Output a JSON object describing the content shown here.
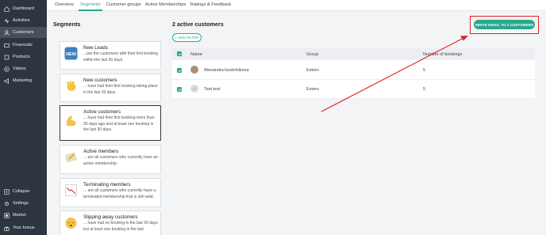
{
  "sidebar": {
    "items": [
      {
        "label": "Dashboard",
        "icon": "home-icon"
      },
      {
        "label": "Activities",
        "icon": "activity-icon"
      },
      {
        "label": "Customers",
        "icon": "customers-icon",
        "active": true
      },
      {
        "label": "Financials",
        "icon": "financials-icon"
      },
      {
        "label": "Products",
        "icon": "products-icon"
      },
      {
        "label": "Videos",
        "icon": "video-icon"
      },
      {
        "label": "Marketing",
        "icon": "marketing-icon"
      }
    ],
    "bottom_items": [
      {
        "label": "Collapse",
        "icon": "collapse-icon"
      },
      {
        "label": "Settings",
        "icon": "settings-icon"
      },
      {
        "label": "Market",
        "icon": "market-icon"
      },
      {
        "label": "Your bonus",
        "icon": "bonus-icon"
      }
    ]
  },
  "tabs": [
    {
      "label": "Overview"
    },
    {
      "label": "Segments",
      "active": true
    },
    {
      "label": "Customer groups"
    },
    {
      "label": "Active Memberships"
    },
    {
      "label": "Ratings & Feedback"
    }
  ],
  "segments": {
    "title": "Segments",
    "items": [
      {
        "name": "New Leads",
        "desc": "...are the customers with their first booking within the last 30 days",
        "icon": "new-badge-icon",
        "icon_text": "NEW"
      },
      {
        "name": "New customers",
        "desc": "... have had their first booking taking place in the last 30 days.",
        "icon": "waving-hand-icon"
      },
      {
        "name": "Active customers",
        "desc": "... have had their first booking more than 30 days ago and at least one booking in the last 30 days.",
        "icon": "flexed-biceps-icon",
        "active": true
      },
      {
        "name": "Active members",
        "desc": "... are all customers who currently have an active membership.",
        "icon": "membership-card-icon"
      },
      {
        "name": "Terminating members",
        "desc": "... are all customers who currently have a terminated membership that is still valid.",
        "icon": "chart-decreasing-icon"
      },
      {
        "name": "Slipping away customers",
        "desc": "... have had no booking in the last 30 days but at least one booking in the last",
        "icon": "sleeping-face-icon"
      }
    ]
  },
  "main": {
    "title": "2 active customers",
    "add_filter": "+ ADD FILTER",
    "email_button": "WRITE EMAIL TO 2 CUSTOMERS",
    "accent_color": "#2aa88a",
    "highlight_color": "#e2232a",
    "table": {
      "columns": [
        "Name",
        "Group",
        "Number of bookings"
      ],
      "rows": [
        {
          "name": "Alexandra kostolnikova",
          "group": "Extern",
          "bookings": "5",
          "avatar": "photo"
        },
        {
          "name": "Test test",
          "group": "Extern",
          "bookings": "5",
          "avatar": "TT"
        }
      ]
    }
  }
}
